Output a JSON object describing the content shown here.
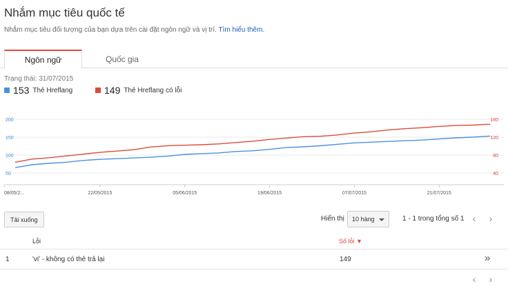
{
  "header": {
    "title": "Nhắm mục tiêu quốc tế",
    "subtitle": "Nhắm mục tiêu đối tượng của bạn dựa trên cài đặt ngôn ngữ và vị trí.",
    "learn_more": "Tìm hiểu thêm."
  },
  "tabs": [
    {
      "label": "Ngôn ngữ",
      "active": true
    },
    {
      "label": "Quốc gia",
      "active": false
    }
  ],
  "status": "Trạng thái: 31/07/2015",
  "legend": [
    {
      "count": "153",
      "label": "Thẻ Hreflang",
      "color": "#4a90e2"
    },
    {
      "count": "149",
      "label": "Thẻ Hreflang có lỗi",
      "color": "#dd4b39"
    }
  ],
  "chart_data": {
    "type": "line",
    "x": [
      "08/05/2015",
      "11/05/2015",
      "14/05/2015",
      "17/05/2015",
      "20/05/2015",
      "23/05/2015",
      "26/05/2015",
      "29/05/2015",
      "01/06/2015",
      "04/06/2015",
      "07/06/2015",
      "10/06/2015",
      "13/06/2015",
      "16/06/2015",
      "19/06/2015",
      "22/06/2015",
      "25/06/2015",
      "28/06/2015",
      "01/07/2015",
      "04/07/2015",
      "07/07/2015",
      "10/07/2015",
      "13/07/2015",
      "16/07/2015",
      "19/07/2015",
      "22/07/2015",
      "25/07/2015",
      "28/07/2015",
      "31/07/2015"
    ],
    "x_tick_labels": [
      "08/05/2...",
      "22/05/2015",
      "05/06/2015",
      "19/06/2015",
      "07/07/2015",
      "21/07/2015"
    ],
    "x_tick_index": [
      0,
      5,
      10,
      15,
      20,
      25
    ],
    "series": [
      {
        "name": "Thẻ Hreflang",
        "axis": "left",
        "color": "#4a90e2",
        "values": [
          65,
          73,
          77,
          80,
          85,
          88,
          90,
          92,
          94,
          97,
          102,
          104,
          106,
          110,
          112,
          116,
          121,
          123,
          126,
          130,
          134,
          136,
          138,
          140,
          142,
          145,
          148,
          150,
          153
        ]
      },
      {
        "name": "Thẻ Hreflang có lỗi",
        "axis": "right",
        "color": "#dd4b39",
        "values": [
          64,
          71,
          74,
          78,
          82,
          86,
          89,
          92,
          98,
          101,
          102,
          103,
          105,
          108,
          111,
          115,
          118,
          121,
          122,
          125,
          129,
          132,
          136,
          139,
          141,
          144,
          146,
          147,
          149
        ]
      }
    ],
    "y_left": {
      "ticks": [
        50,
        100,
        150,
        200
      ],
      "lim": [
        50,
        200
      ],
      "color": "#4a90e2"
    },
    "y_right": {
      "ticks": [
        40,
        80,
        120,
        160
      ],
      "lim": [
        40,
        160
      ],
      "color": "#dd4b39"
    },
    "grid": true
  },
  "toolbar": {
    "download": "Tải xuống",
    "show_label": "Hiển thị",
    "rows_select": "10 hàng",
    "range": "1 - 1 trong tổng số 1"
  },
  "table": {
    "headers": {
      "error": "Lỗi",
      "count": "Số lỗi ▼"
    },
    "rows": [
      {
        "index": "1",
        "error": "'vi' - không có thẻ trả lại",
        "count": "149"
      }
    ]
  },
  "icons": {
    "prev": "chevron-left-icon",
    "next": "chevron-right-icon",
    "open": "double-chevron-right-icon"
  }
}
